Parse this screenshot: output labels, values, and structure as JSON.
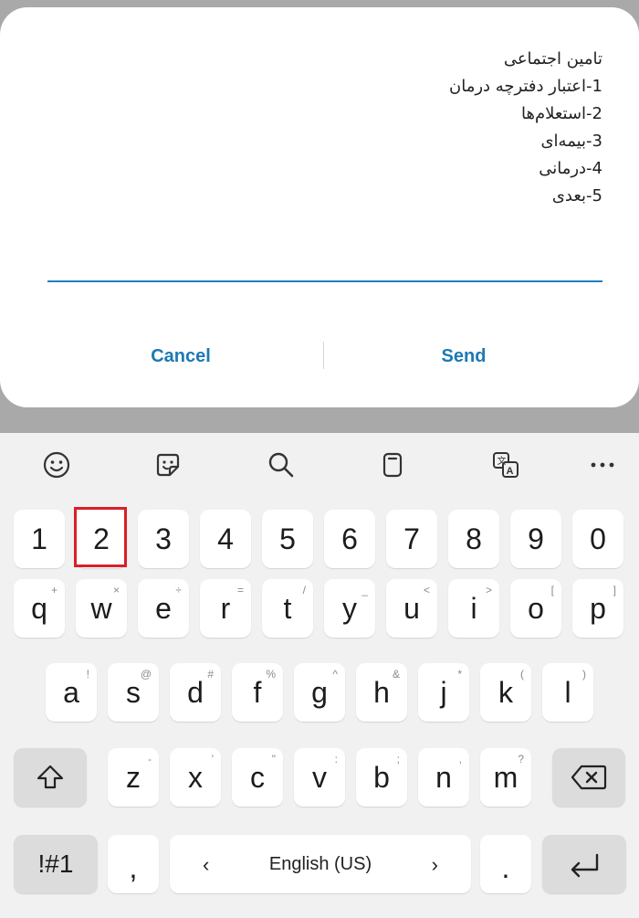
{
  "dialog": {
    "message_lines": [
      "تامین اجتماعی",
      "1-اعتبار دفترچه درمان",
      "2-استعلام‌ها",
      "3-بیمه‌ای",
      "4-درمانی",
      "5-بعدی"
    ],
    "cancel_label": "Cancel",
    "send_label": "Send"
  },
  "toolbar": {
    "icons": [
      "emoji-icon",
      "sticker-icon",
      "search-icon",
      "clipboard-icon",
      "translate-icon",
      "more-icon"
    ]
  },
  "keyboard": {
    "number_row": [
      "1",
      "2",
      "3",
      "4",
      "5",
      "6",
      "7",
      "8",
      "9",
      "0"
    ],
    "row1": [
      {
        "key": "q",
        "alt": "+"
      },
      {
        "key": "w",
        "alt": "×"
      },
      {
        "key": "e",
        "alt": "÷"
      },
      {
        "key": "r",
        "alt": "="
      },
      {
        "key": "t",
        "alt": "/"
      },
      {
        "key": "y",
        "alt": "_"
      },
      {
        "key": "u",
        "alt": "<"
      },
      {
        "key": "i",
        "alt": ">"
      },
      {
        "key": "o",
        "alt": "["
      },
      {
        "key": "p",
        "alt": "]"
      }
    ],
    "row2": [
      {
        "key": "a",
        "alt": "!"
      },
      {
        "key": "s",
        "alt": "@"
      },
      {
        "key": "d",
        "alt": "#"
      },
      {
        "key": "f",
        "alt": "%"
      },
      {
        "key": "g",
        "alt": "^"
      },
      {
        "key": "h",
        "alt": "&"
      },
      {
        "key": "j",
        "alt": "*"
      },
      {
        "key": "k",
        "alt": "("
      },
      {
        "key": "l",
        "alt": ")"
      }
    ],
    "row3": [
      {
        "key": "z",
        "alt": "-"
      },
      {
        "key": "x",
        "alt": "'"
      },
      {
        "key": "c",
        "alt": "\""
      },
      {
        "key": "v",
        "alt": ":"
      },
      {
        "key": "b",
        "alt": ";"
      },
      {
        "key": "n",
        "alt": ","
      },
      {
        "key": "m",
        "alt": "?"
      }
    ],
    "symbols_label": "!#1",
    "comma_label": ",",
    "period_label": ".",
    "language_label": "English (US)",
    "left_arrow": "‹",
    "right_arrow": "›",
    "highlighted_key": "2",
    "highlight_color": "#d8202a"
  }
}
